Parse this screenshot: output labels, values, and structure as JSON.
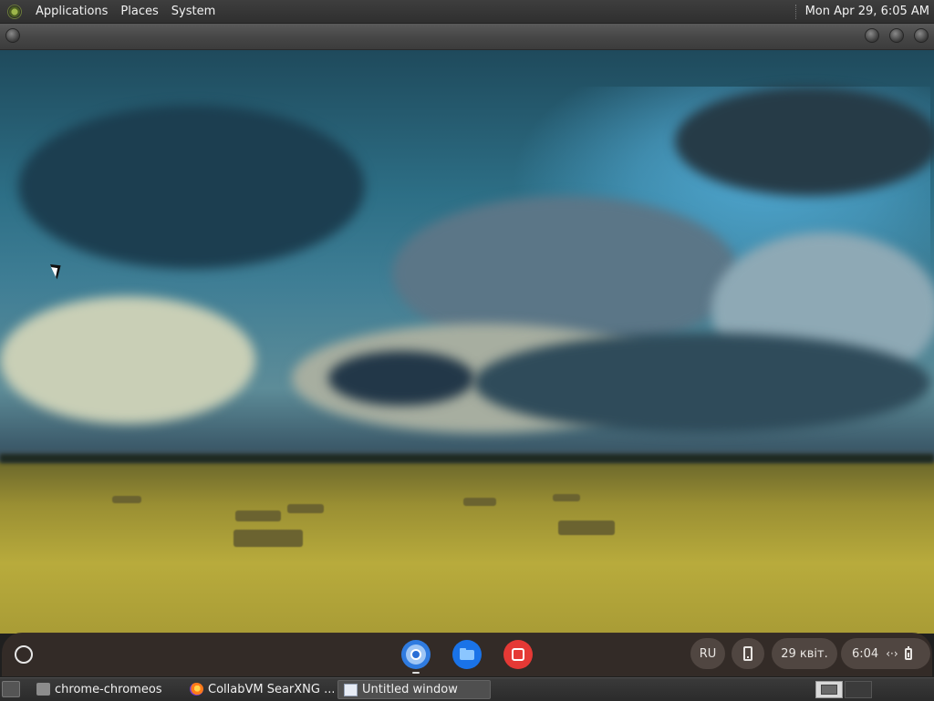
{
  "top_panel": {
    "menus": [
      "Applications",
      "Places",
      "System"
    ],
    "clock": "Mon Apr 29, 6:05 AM"
  },
  "frame_bar": {
    "buttons": [
      "window-menu",
      "minimize",
      "maximize",
      "close"
    ]
  },
  "shelf": {
    "apps": [
      {
        "name": "Chrome",
        "icon": "chrome-icon"
      },
      {
        "name": "Files",
        "icon": "folder-icon"
      },
      {
        "name": "Screenshot",
        "icon": "screenshot-icon"
      }
    ],
    "input_method": "RU",
    "date": "29 квіт.",
    "time": "6:04"
  },
  "taskbar": {
    "tasks": [
      {
        "label": "chrome-chromeos",
        "icon": "folder-icon"
      },
      {
        "label": "CollabVM SearXNG ...",
        "icon": "firefox-icon"
      },
      {
        "label": "Untitled window",
        "icon": "window-icon",
        "active": true
      }
    ]
  }
}
